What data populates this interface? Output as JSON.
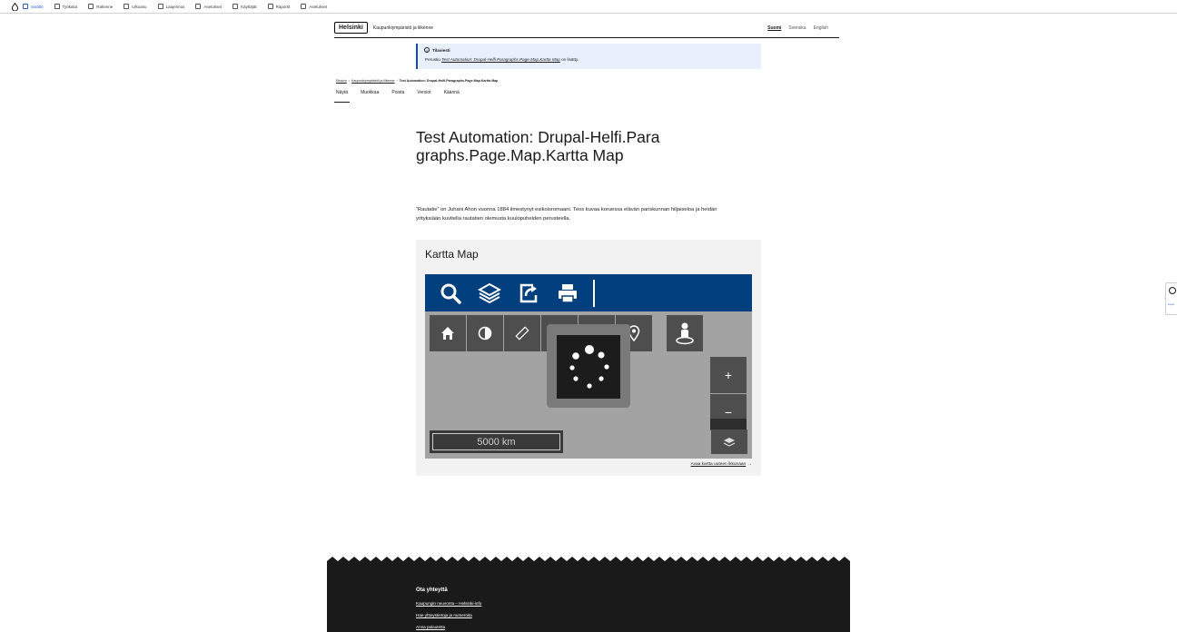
{
  "admin": {
    "items": [
      {
        "label": "Sisältö",
        "active": true
      },
      {
        "label": "Työkalut",
        "active": false
      },
      {
        "label": "Rakenne",
        "active": false
      },
      {
        "label": "Ulkoasu",
        "active": false
      },
      {
        "label": "Laajennus",
        "active": false
      },
      {
        "label": "Asetukset",
        "active": false
      },
      {
        "label": "Käyttäjät",
        "active": false
      },
      {
        "label": "Raportit",
        "active": false
      },
      {
        "label": "Asetukset",
        "active": false
      }
    ]
  },
  "header": {
    "logo": "Helsinki",
    "site_name": "Kaupunkiympäristö ja liikenne",
    "languages": [
      "Suomi",
      "Svenska",
      "English"
    ]
  },
  "notice": {
    "title": "Tilaviesti",
    "prefix": "Perustiu ",
    "link": "Test Automation: Drupal-Helfi.Paragraphs.Page.Map.Kartta Map",
    "suffix": " on lisätty."
  },
  "breadcrumb": {
    "home": "Etusivu",
    "parent": "Kaupunkiympäristö ja liikenne",
    "current": "Test Automation: Drupal-Helfi.Paragraphs.Page.Map.Kartta Map"
  },
  "tabs": [
    "Näytä",
    "Muokkaa",
    "Poista",
    "Versiot",
    "Käännä"
  ],
  "page": {
    "title": "Test Automation: Drupal-Helfi.Paragraphs.Page.Map.Kartta Map",
    "lead": "”Rautatie” on Juhani Ahon vuonna 1884 ilmestynyt esikoisromaani. Teos kuvaa koruessa elävän pariskunnan hiljaiseloa ja heidän yrityksiään kuvitella rautatien olemusta kuulopuheiden perusteella."
  },
  "map": {
    "title": "Kartta Map",
    "scale": "5000 km",
    "zoom_in": "+",
    "zoom_out": "−",
    "open_link": "Avaa kartta uuteen ikkunaan",
    "open_arrow": "→"
  },
  "footer": {
    "heading": "Ota yhteyttä",
    "links": [
      "Kaupungin neuvonta – Helsinki-info",
      "Hae yhteystietoja ja numeroita",
      "Anna palautetta"
    ]
  },
  "colors": {
    "map_toolbar": "#013f7f",
    "notice_bg": "#e8f1fb",
    "footer": "#1a1a1a"
  }
}
